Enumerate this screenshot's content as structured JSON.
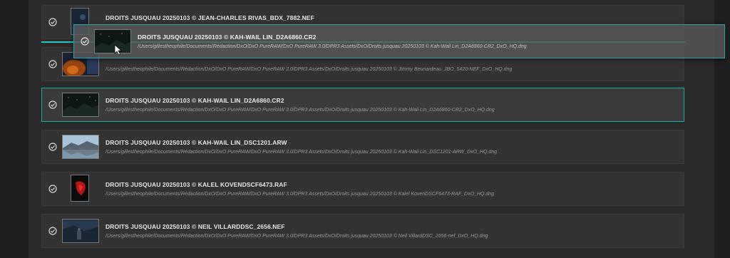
{
  "items": [
    {
      "title": "DROITS JUSQUAU 20250103 © JEAN-CHARLES RIVAS_BDX_7882.NEF",
      "path": "",
      "thumb_color": "#1d2a3a"
    },
    {
      "title": "",
      "path": "/Users/gillestheophile/Documents/Rédaction/DxO/DxO PureRAW/DxO PureRAW 3.0/DPR3 Assets/DxO/Droits jusquau 20250103 © Jimmy Beunardeau_JBO_5420-NEF_DxO_HQ.dng",
      "thumb_color": "#8a3a10"
    },
    {
      "title": "DROITS JUSQUAU 20250103 © KAH-WAIL LIN_D2A6860.CR2",
      "path": "/Users/gillestheophile/Documents/Rédaction/DxO/DxO PureRAW/DxO PureRAW 3.0/DPR3 Assets/DxO/Droits jusquau 20250103 © Kah-Wail Lin_D2A6860-CR2_DxO_HQ.dng",
      "thumb_color": "#0f1a16"
    },
    {
      "title": "DROITS JUSQUAU 20250103 © KAH-WAIL LIN_DSC1201.ARW",
      "path": "/Users/gillestheophile/Documents/Rédaction/DxO/DxO PureRAW/DxO PureRAW 3.0/DPR3 Assets/DxO/Droits jusquau 20250103 © Kah-Wail Lin_DSC1201-ARW_DxO_HQ.dng",
      "thumb_color": "#8fb0c8"
    },
    {
      "title": "DROITS JUSQUAU 20250103 © KALEL KOVENDSCF6473.RAF",
      "path": "/Users/gillestheophile/Documents/Rédaction/DxO/DxO PureRAW/DxO PureRAW 3.0/DPR3 Assets/DxO/Droits jusquau 20250103 © Kalel KovenDSCF6473-RAF_DxO_HQ.dng",
      "thumb_color": "#0a0a0a"
    },
    {
      "title": "DROITS JUSQUAU 20250103 © NEIL VILLARDDSC_2656.NEF",
      "path": "/Users/gillestheophile/Documents/Rédaction/DxO/DxO PureRAW/DxO PureRAW 3.0/DPR3 Assets/DxO/Droits jusquau 20250103 © Neil VillardDSC_2656-nef_DxO_HQ.dng",
      "thumb_color": "#243444"
    }
  ],
  "drag_ghost": {
    "title": "DROITS JUSQUAU 20250103 © KAH-WAIL LIN_D2A6860.CR2",
    "path": "/Users/gillestheophile/Documents/Rédaction/DxO/DxO PureRAW/DxO PureRAW 3.0/DPR3 Assets/DxO/Droits jusquau 20250103 © Kah-Wail Lin_D2A6860-CR2_DxO_HQ.dng"
  },
  "colors": {
    "accent": "#1fc4c4",
    "row_bg": "#333333",
    "selected_border": "#1aa8a8"
  },
  "icons": {
    "check": "check-circle-icon",
    "cursor": "cursor-arrow-icon"
  }
}
